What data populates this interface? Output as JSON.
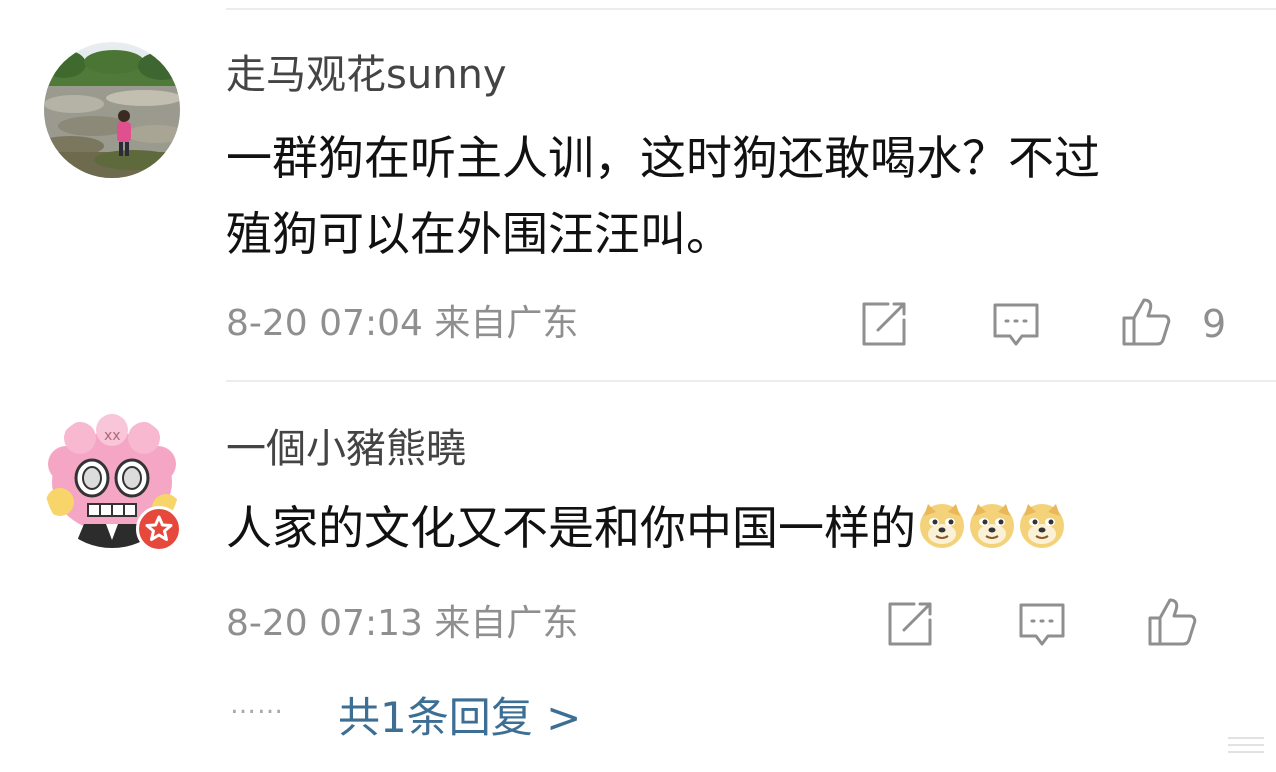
{
  "comments": [
    {
      "username": "走马观花sunny",
      "text_lines": [
        "一群狗在听主人训，这时狗还敢喝水？不过",
        "殖狗可以在外围汪汪叫。"
      ],
      "meta": "8-20 07:04 来自广东",
      "like_count": "9",
      "avatar": "photo-avatar"
    },
    {
      "username": "一個小豬熊曉",
      "text": "人家的文化又不是和你中国一样的",
      "emojis": [
        "doge-emoji",
        "doge-emoji",
        "doge-emoji"
      ],
      "meta": "8-20 07:13 来自广东",
      "like_count": "",
      "avatar": "cartoon-avatar",
      "badge": "verified-star-badge"
    }
  ],
  "replies": {
    "dots": "……",
    "link": "共1条回复 >"
  },
  "colors": {
    "link": "#3d6e93",
    "meta": "#8f8f8f",
    "text": "#111111",
    "username": "#444444",
    "divider": "#ececec",
    "badge": "#e6493b"
  },
  "icons": [
    "share-icon",
    "comment-icon",
    "like-icon"
  ]
}
